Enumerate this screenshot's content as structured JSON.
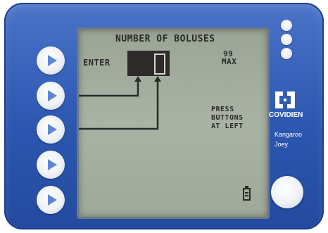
{
  "colors": {
    "body_blue": "#2c57b0",
    "lcd_bg": "#a3ad9f",
    "lcd_ink": "#2a2a2a",
    "arrow_blue": "#5e86d4"
  },
  "side_buttons": [
    {
      "icon": "play-triangle-icon"
    },
    {
      "icon": "play-triangle-icon"
    },
    {
      "icon": "play-triangle-icon"
    },
    {
      "icon": "play-triangle-icon"
    },
    {
      "icon": "play-triangle-icon"
    }
  ],
  "screen": {
    "title": "NUMBER OF BOLUSES",
    "enter_label": "ENTER",
    "entry_digit": "0",
    "max_count": "99",
    "max_label": "MAX",
    "instruction_lines": [
      "PRESS",
      "BUTTONS",
      "AT LEFT"
    ],
    "battery_icon": "battery-icon"
  },
  "brand": {
    "logo_icon": "covidien-logo-icon",
    "name": "COVIDIEN",
    "model_line1": "Kangaroo",
    "model_line2": "Joey"
  },
  "top_indicators": 3,
  "right_button_icon": "round-button"
}
